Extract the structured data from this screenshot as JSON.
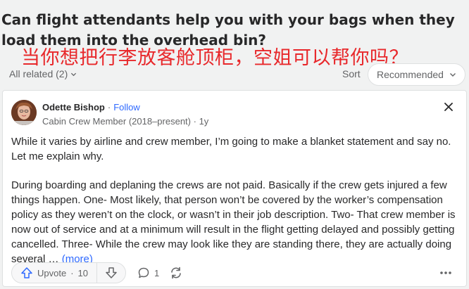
{
  "question": {
    "title": "Can flight attendants help you with your bags when they load them into the overhead bin?"
  },
  "overlay_caption": "当你想把行李放客舱顶柜，空姐可以帮你吗？",
  "related": {
    "label": "All related (2)"
  },
  "sort": {
    "label": "Sort",
    "selected": "Recommended"
  },
  "answer": {
    "author": {
      "name": "Odette Bishop",
      "follow_label": "Follow",
      "credential": "Cabin Crew Member (2018–present)",
      "age": "1y"
    },
    "paragraphs": [
      "While it varies by airline and crew member, I’m going to make a blanket statement and say no. Let me explain why.",
      "During boarding and deplaning the crews are not paid. Basically if the crew gets injured a few things happen. One- Most likely, that person won’t be covered by the worker’s compensation policy as they weren’t on the clock, or wasn’t in their job description. Two- That crew member is now out of service and at a minimum will result in the flight getting delayed and possibly getting cancelled. Three- While the crew may look like they are standing there, they are actually doing several …"
    ],
    "more_label": "(more)"
  },
  "actions": {
    "upvote_label": "Upvote",
    "upvote_count": "10",
    "comment_count": "1"
  },
  "colors": {
    "accent_link": "#2e69ff",
    "caption_red": "#e8282b",
    "text_primary": "#282829",
    "text_secondary": "#636466"
  }
}
